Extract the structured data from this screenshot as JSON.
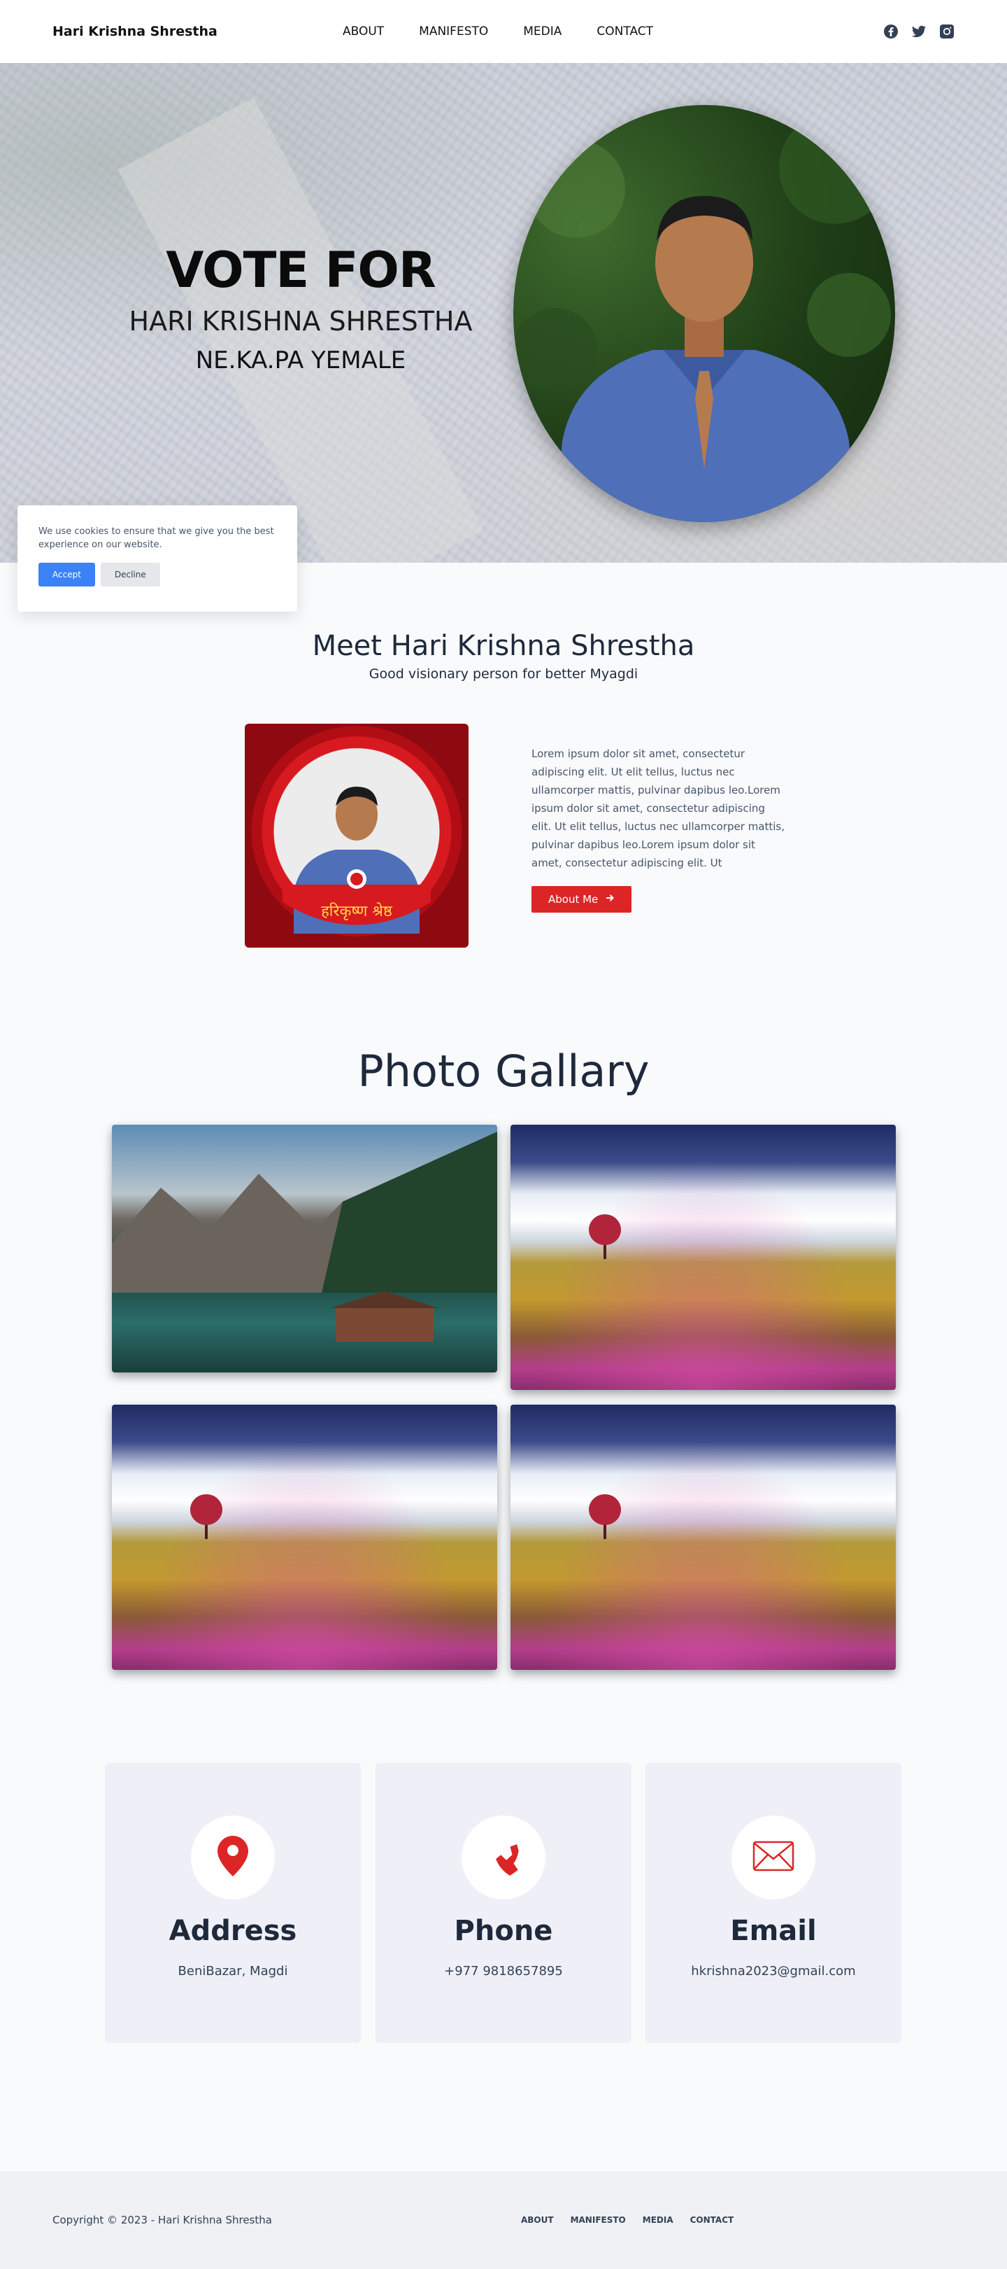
{
  "nav": {
    "brand": "Hari Krishna Shrestha",
    "links": [
      "ABOUT",
      "MANIFESTO",
      "MEDIA",
      "CONTACT"
    ],
    "social_icons": [
      "facebook-icon",
      "twitter-icon",
      "instagram-icon"
    ]
  },
  "hero": {
    "headline": "VOTE FOR",
    "name": "HARI KRISHNA SHRESTHA",
    "party": "NE.KA.PA YEMALE"
  },
  "cookie": {
    "message": "We use cookies to ensure that we give you the best experience on our website.",
    "accept_label": "Accept",
    "decline_label": "Decline"
  },
  "meet": {
    "title": "Meet Hari Krishna Shrestha",
    "subtitle": "Good visionary person for better Myagdi",
    "body": "Lorem ipsum dolor sit amet, consectetur adipiscing elit. Ut elit tellus, luctus nec ullamcorper mattis, pulvinar dapibus leo.Lorem ipsum dolor sit amet, consectetur adipiscing elit. Ut elit tellus, luctus nec ullamcorper mattis, pulvinar dapibus leo.Lorem ipsum dolor sit amet, consectetur adipiscing elit. Ut",
    "button_label": "About Me",
    "poster_name": "हरिकृष्ण श्रेष्ठ"
  },
  "gallery": {
    "title": "Photo Gallary"
  },
  "contact": {
    "address": {
      "title": "Address",
      "value": "BeniBazar, Magdi"
    },
    "phone": {
      "title": "Phone",
      "value": "+977 9818657895"
    },
    "email": {
      "title": "Email",
      "value": "hkrishna2023@gmail.com"
    }
  },
  "footer": {
    "copyright": "Copyright © 2023 - Hari Krishna Shrestha",
    "links": [
      "ABOUT",
      "MANIFESTO",
      "MEDIA",
      "CONTACT"
    ]
  },
  "colors": {
    "accent_red": "#dc2626",
    "accept_blue": "#3b82f6",
    "shirt_blue": "#4f6fb9"
  }
}
